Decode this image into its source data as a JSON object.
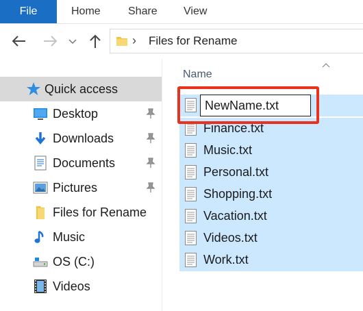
{
  "ribbon": {
    "tabs": [
      "File",
      "Home",
      "Share",
      "View"
    ]
  },
  "address": {
    "path_segment": "Files for Rename"
  },
  "nav": {
    "quick_access": "Quick access",
    "items": [
      {
        "label": "Desktop",
        "icon": "desktop-icon",
        "pinned": true
      },
      {
        "label": "Downloads",
        "icon": "download-arrow-icon",
        "pinned": true
      },
      {
        "label": "Documents",
        "icon": "document-icon",
        "pinned": true
      },
      {
        "label": "Pictures",
        "icon": "pictures-icon",
        "pinned": true
      },
      {
        "label": "Files for Rename",
        "icon": "folder-icon",
        "pinned": false
      },
      {
        "label": "Music",
        "icon": "music-note-icon",
        "pinned": false
      },
      {
        "label": "OS (C:)",
        "icon": "drive-icon",
        "pinned": false
      },
      {
        "label": "Videos",
        "icon": "film-icon",
        "pinned": false
      }
    ]
  },
  "files": {
    "column_name": "Name",
    "rename_value": "NewName.txt",
    "items": [
      "Finance.txt",
      "Music.txt",
      "Personal.txt",
      "Shopping.txt",
      "Vacation.txt",
      "Videos.txt",
      "Work.txt"
    ]
  },
  "colors": {
    "file_tab": "#1a6fc4",
    "selection": "#cce8ff",
    "quick_access_bg": "#d9d9d9",
    "highlight_border": "#e8321e"
  }
}
